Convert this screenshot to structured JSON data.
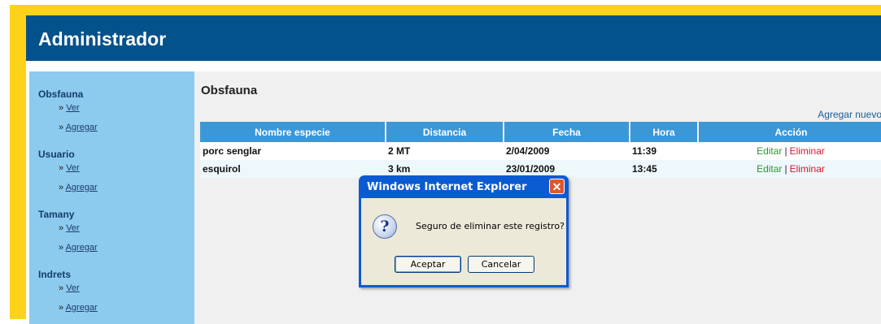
{
  "header": {
    "title": "Administrador"
  },
  "sidebar": {
    "sections": [
      {
        "title": "Obsfauna",
        "links": [
          "Ver",
          "Agregar"
        ]
      },
      {
        "title": "Usuario",
        "links": [
          "Ver",
          "Agregar"
        ]
      },
      {
        "title": "Tamany",
        "links": [
          "Ver",
          "Agregar"
        ]
      },
      {
        "title": "Indrets",
        "links": [
          "Ver",
          "Agregar"
        ]
      }
    ],
    "link_prefix": "»"
  },
  "main": {
    "title": "Obsfauna",
    "add_new": "Agregar nuevo",
    "columns": [
      "Nombre especie",
      "Distancia",
      "Fecha",
      "Hora",
      "Acción"
    ],
    "rows": [
      {
        "nombre": "porc senglar",
        "distancia": "2 MT",
        "fecha": "2/04/2009",
        "hora": "11:39",
        "editar": "Editar",
        "sep": "|",
        "eliminar": "Eliminar"
      },
      {
        "nombre": "esquirol",
        "distancia": "3 km",
        "fecha": "23/01/2009",
        "hora": "13:45",
        "editar": "Editar",
        "sep": "|",
        "eliminar": "Eliminar"
      }
    ]
  },
  "dialog": {
    "title": "Windows Internet Explorer",
    "close_glyph": "✕",
    "icon": "question-icon",
    "icon_glyph": "?",
    "message": "Seguro de eliminar este registro?",
    "ok_label": "Aceptar",
    "cancel_label": "Cancelar"
  },
  "colors": {
    "frame": "#ffd21a",
    "header": "#03528c",
    "sidebar": "#8ccbed",
    "table_header": "#3c97d7",
    "edit_link": "#2a9a2a",
    "delete_link": "#d6192a"
  }
}
